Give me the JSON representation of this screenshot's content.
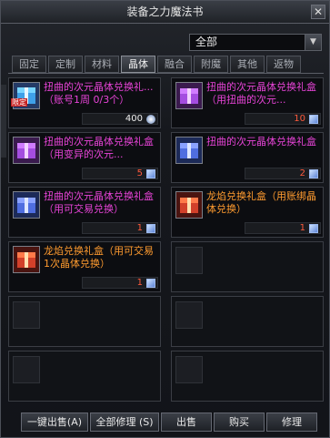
{
  "window": {
    "title": "装备之力魔法书",
    "close_glyph": "✕"
  },
  "filter": {
    "selected": "全部"
  },
  "tabs": [
    {
      "label": "固定"
    },
    {
      "label": "定制"
    },
    {
      "label": "材料"
    },
    {
      "label": "晶体",
      "active": true
    },
    {
      "label": "融合"
    },
    {
      "label": "附魔"
    },
    {
      "label": "其他"
    },
    {
      "label": "返物"
    }
  ],
  "items": [
    {
      "name": "扭曲的次元晶体兑换礼... （账号1周 0/3个）",
      "color": "#e844d8",
      "tag": "限定",
      "quantity": "400",
      "currency": "orb",
      "icon": "crystal-chest-cyan-icon"
    },
    {
      "name": "扭曲的次元晶体兑换礼盒（用扭曲的次元...",
      "color": "#e844d8",
      "quantity": "10",
      "quantity_red": true,
      "currency": "cube",
      "icon": "purple-chest-icon"
    },
    {
      "name": "扭曲的次元晶体兑换礼盒（用变异的次元...",
      "color": "#e844d8",
      "quantity": "5",
      "quantity_red": true,
      "currency": "cube",
      "icon": "purple-chest-icon"
    },
    {
      "name": "扭曲的次元晶体兑换礼盒",
      "color": "#e844d8",
      "quantity": "2",
      "quantity_red": true,
      "currency": "cube",
      "icon": "blue-chest-icon"
    },
    {
      "name": "扭曲的次元晶体兑换礼盒（用可交易兑换）",
      "color": "#e844d8",
      "quantity": "1",
      "quantity_red": true,
      "currency": "cube",
      "icon": "blue-chest-icon"
    },
    {
      "name": "龙焰兑换礼盒（用账绑晶体兑换）",
      "color": "#ff9b2f",
      "quantity": "1",
      "quantity_red": true,
      "currency": "cube",
      "icon": "red-chest-icon"
    },
    {
      "name": "龙焰兑换礼盒（用可交易1次晶体兑换）",
      "color": "#ff9b2f",
      "quantity": "1",
      "quantity_red": true,
      "currency": "cube",
      "icon": "red-chest-icon"
    }
  ],
  "buttons": {
    "sell_all": "一键出售(A)",
    "repair_all": "全部修理 (S)",
    "sell": "出售",
    "buy": "购买",
    "repair": "修理"
  }
}
